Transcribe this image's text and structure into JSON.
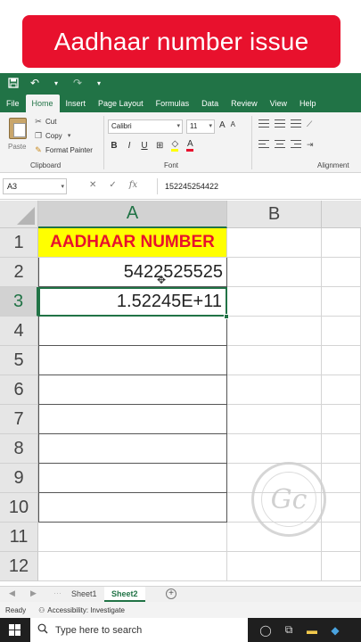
{
  "banner": {
    "text": "Aadhaar number issue"
  },
  "tabs": [
    "File",
    "Home",
    "Insert",
    "Page Layout",
    "Formulas",
    "Data",
    "Review",
    "View",
    "Help"
  ],
  "ribbon": {
    "paste_label": "Paste",
    "cut_label": "Cut",
    "copy_label": "Copy",
    "format_painter_label": "Format Painter",
    "clipboard_group": "Clipboard",
    "font_name": "Calibri",
    "font_size": "11",
    "font_group": "Font",
    "alignment_group": "Alignment",
    "bold": "B",
    "italic": "I",
    "underline": "U",
    "grow_font": "A",
    "shrink_font": "A",
    "font_color_glyph": "A"
  },
  "formula_bar": {
    "name_box": "A3",
    "value": "152245254422"
  },
  "columns": [
    "A",
    "B"
  ],
  "rows": [
    "1",
    "2",
    "3",
    "4",
    "5",
    "6",
    "7",
    "8",
    "9",
    "10",
    "11",
    "12"
  ],
  "cells": {
    "a1": "AADHAAR NUMBER",
    "a2": "5422525525",
    "a3": "1.52245E+11"
  },
  "sheets": [
    "Sheet1",
    "Sheet2"
  ],
  "active_sheet": "Sheet2",
  "status": {
    "ready": "Ready",
    "accessibility": "Accessibility: Investigate"
  },
  "taskbar": {
    "search_placeholder": "Type here to search"
  },
  "colors": {
    "excel_green": "#217346",
    "banner_red": "#e8112d",
    "header_fill": "#ffff00"
  }
}
